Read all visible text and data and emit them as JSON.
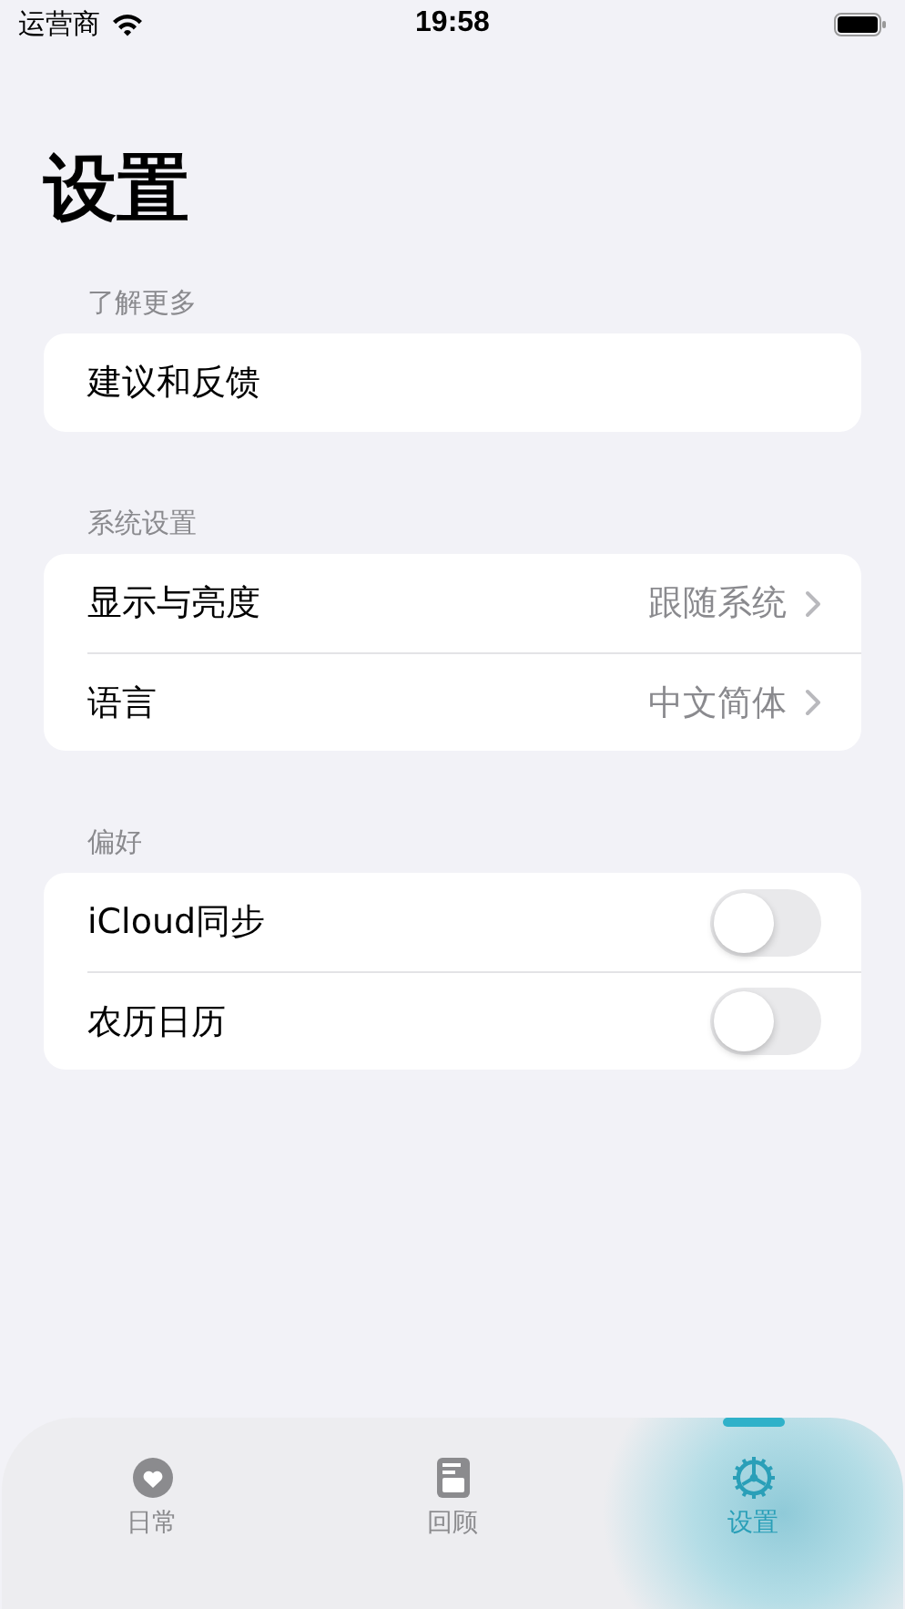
{
  "status_bar": {
    "carrier": "运营商",
    "time": "19:58"
  },
  "title": "设置",
  "sections": [
    {
      "header": "了解更多",
      "rows": [
        {
          "kind": "link",
          "label": "建议和反馈"
        }
      ]
    },
    {
      "header": "系统设置",
      "rows": [
        {
          "kind": "value",
          "label": "显示与亮度",
          "value": "跟随系统"
        },
        {
          "kind": "value",
          "label": "语言",
          "value": "中文简体"
        }
      ]
    },
    {
      "header": "偏好",
      "rows": [
        {
          "kind": "toggle",
          "label": "iCloud同步",
          "on": false
        },
        {
          "kind": "toggle",
          "label": "农历日历",
          "on": false
        }
      ]
    }
  ],
  "tabs": [
    {
      "kind": "heart",
      "label": "日常",
      "selected": false
    },
    {
      "kind": "book",
      "label": "回顾",
      "selected": false
    },
    {
      "kind": "gear",
      "label": "设置",
      "selected": true
    }
  ]
}
